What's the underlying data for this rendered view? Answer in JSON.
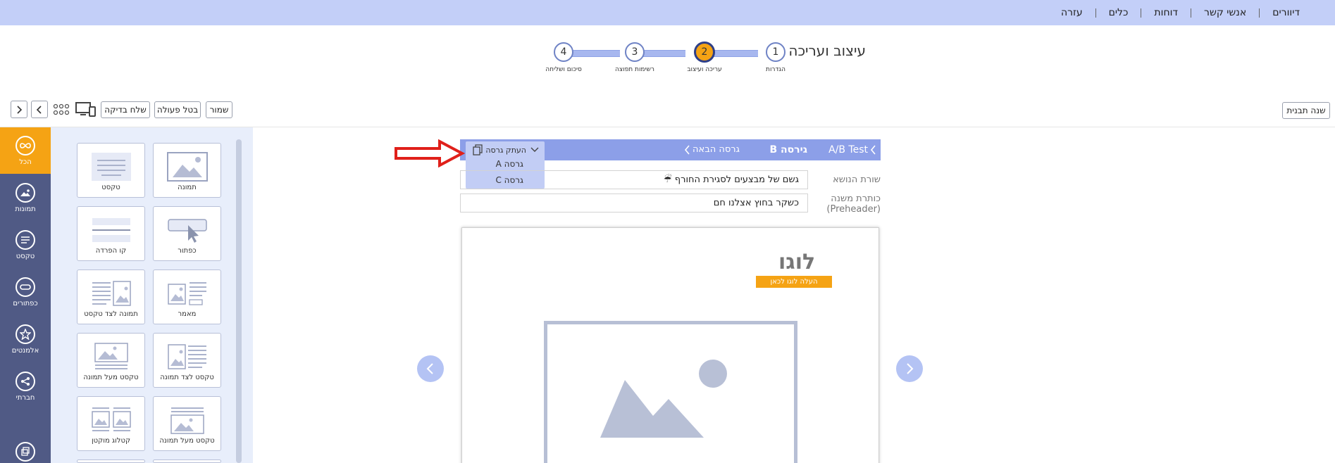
{
  "topnav": {
    "items": [
      "דיוורים",
      "אנשי קשר",
      "דוחות",
      "כלים",
      "עזרה"
    ]
  },
  "page_title": "עיצוב ועריכה",
  "stepper": {
    "active_step": 2,
    "steps": [
      {
        "num": "1",
        "label": "הגדרות"
      },
      {
        "num": "2",
        "label": "עריכה ועיצוב"
      },
      {
        "num": "3",
        "label": "רשימות תפוצה"
      },
      {
        "num": "4",
        "label": "סיכום ושליחה"
      }
    ]
  },
  "toolbar": {
    "change_template": "שנה תבנית",
    "save": "שמור",
    "undo": "בטל פעולה",
    "send_test": "שלח בדיקה"
  },
  "sidebar": {
    "items": [
      {
        "label": "הכל",
        "icon": "infinity-icon"
      },
      {
        "label": "תמונות",
        "icon": "image-icon"
      },
      {
        "label": "טקסט",
        "icon": "text-icon"
      },
      {
        "label": "כפתורים",
        "icon": "button-icon"
      },
      {
        "label": "אלמנטים",
        "icon": "star-icon"
      },
      {
        "label": "חברתי",
        "icon": "share-icon"
      }
    ]
  },
  "palette": {
    "tiles": [
      {
        "label": "תמונה"
      },
      {
        "label": "טקסט"
      },
      {
        "label": "כפתור"
      },
      {
        "label": "קו הפרדה"
      },
      {
        "label": "מאמר"
      },
      {
        "label": "תמונה לצד טקסט"
      },
      {
        "label": "טקסט לצד תמונה"
      },
      {
        "label": "טקסט מעל תמונה"
      },
      {
        "label": "טקסט מעל תמונה"
      },
      {
        "label": "קטלוג מוקטן"
      }
    ]
  },
  "ab_test": {
    "title": "A/B Test",
    "current_version": "גירסה B",
    "next_version": "גרסה הבאה",
    "copy_label": "העתק גרסה",
    "copy_options": [
      "גרסה A",
      "גרסה C"
    ]
  },
  "fields": {
    "subject_label": "שורת הנושא",
    "subject_value": "גשם של מבצעים לסגירת החורף ☔",
    "preheader_label_1": "כותרת משנה",
    "preheader_label_2": "(Preheader)",
    "preheader_value": "כשקר בחוץ אצלנו חם"
  },
  "preview": {
    "logo_text": "לוגו",
    "upload_logo": "העלה לוגו לכאן"
  }
}
